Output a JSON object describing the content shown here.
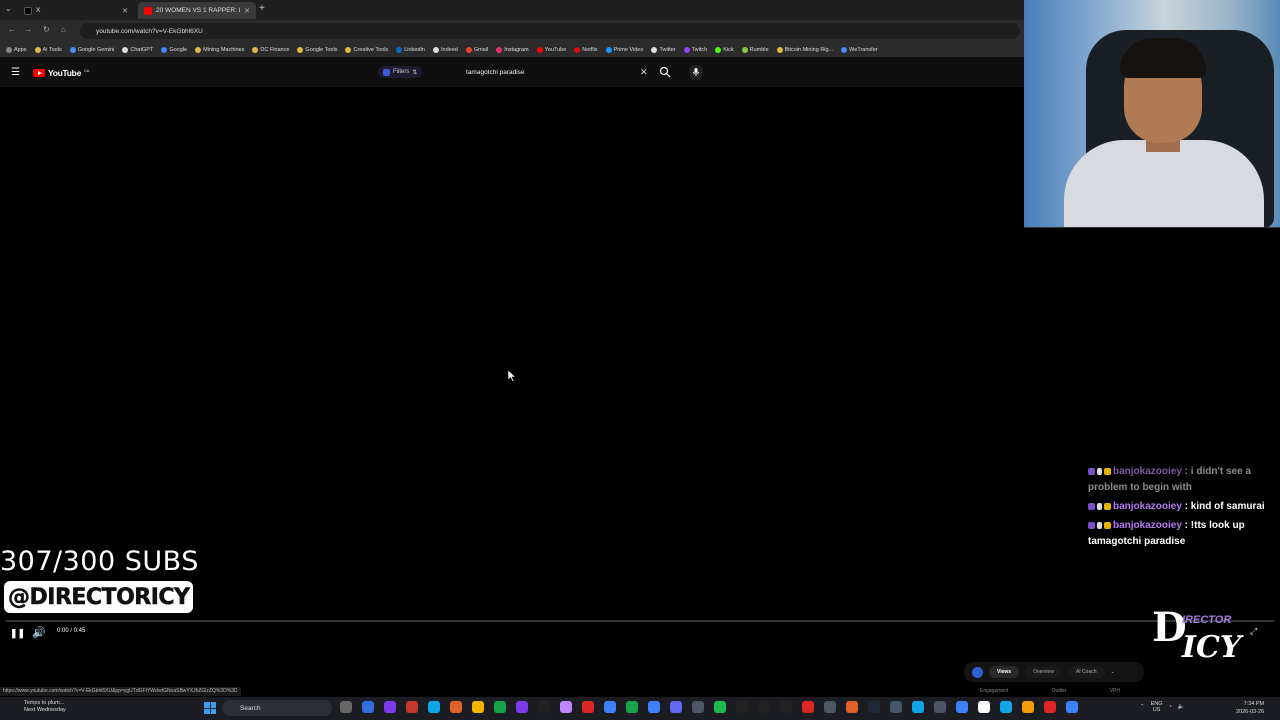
{
  "browser": {
    "tabs": [
      {
        "label": "X",
        "favicon_color": "#000000"
      },
      {
        "label": "20 WOMEN VS 1 RAPPER: I",
        "favicon_color": "#ff0000"
      }
    ],
    "url": "youtube.com/watch?v=V-EkGbhl6XU",
    "bookmarks": [
      {
        "label": "Apps",
        "color": "#888888"
      },
      {
        "label": "Ai Tools",
        "color": "#e0b84a"
      },
      {
        "label": "Google Gemini",
        "color": "#4a8ef0"
      },
      {
        "label": "ChatGPT",
        "color": "#dddddd"
      },
      {
        "label": "Google",
        "color": "#4285f4"
      },
      {
        "label": "Mining Machines",
        "color": "#e0b84a"
      },
      {
        "label": "DC Finance",
        "color": "#e0b84a"
      },
      {
        "label": "Google Tools",
        "color": "#e0b84a"
      },
      {
        "label": "Creative Tools",
        "color": "#e0b84a"
      },
      {
        "label": "LinkedIn",
        "color": "#0a66c2"
      },
      {
        "label": "Indeed",
        "color": "#dddddd"
      },
      {
        "label": "Gmail",
        "color": "#ea4335"
      },
      {
        "label": "Instagram",
        "color": "#e1306c"
      },
      {
        "label": "YouTube",
        "color": "#ff0000"
      },
      {
        "label": "Netflix",
        "color": "#e50914"
      },
      {
        "label": "Prime Video",
        "color": "#1a98ff"
      },
      {
        "label": "Twitter",
        "color": "#dddddd"
      },
      {
        "label": "Twitch",
        "color": "#9146ff"
      },
      {
        "label": "Kick",
        "color": "#53fc18"
      },
      {
        "label": "Rumble",
        "color": "#85c742"
      },
      {
        "label": "Bitcoin Mining Rig...",
        "color": "#e0b84a"
      },
      {
        "label": "WeTransfer",
        "color": "#4a8ef0"
      }
    ],
    "status_url": "https://www.youtube.com/watch?v=V-EkGbhl6XU&pp=ygUTdGFtYWdvdGNoaSBwYXJhZGlzZQ%3D%3D"
  },
  "youtube": {
    "logo_text": "YouTube",
    "country": "CA",
    "filters_label": "Filters",
    "search_value": "tamagotchi paradise",
    "player": {
      "time": "0:00 / 0:45",
      "progress": 0
    }
  },
  "overlay": {
    "subs_count": "307/300 SUBS",
    "handle": "@DIRECTORICY",
    "logo_irector": "IRECTOR",
    "logo_d": "D",
    "logo_icy": "ICY"
  },
  "chat": [
    {
      "user": "banjokazooiey",
      "text": "i didn't see a problem to begin with"
    },
    {
      "user": "banjokazooiey",
      "text": "kind of samurai"
    },
    {
      "user": "banjokazooiey",
      "text": "!tts look up tamagotchi paradise"
    }
  ],
  "extension": {
    "tabs": [
      "Views",
      "Overview",
      "AI Coach"
    ],
    "labels": [
      "Engagement",
      "Outlier",
      "VPH"
    ]
  },
  "taskbar": {
    "weather_title": "Temps to plum...",
    "weather_sub": "Next Wednesday",
    "search_placeholder": "Search",
    "lang": "ENG",
    "region": "US",
    "time": "7:34 PM",
    "date": "2026-03-26",
    "app_colors": [
      "#666666",
      "#2f6fe0",
      "#7c3aed",
      "#c0392b",
      "#0ea5e9",
      "#e0612a",
      "#f5b400",
      "#16a34a",
      "#7c3aed",
      "#222222",
      "#c084fc",
      "#dc2626",
      "#3b82f6",
      "#16a34a",
      "#3b82f6",
      "#6366f1",
      "#4b5563",
      "#1db954",
      "#222222",
      "#222222",
      "#222222",
      "#dc2626",
      "#4b5563",
      "#e0612a",
      "#1f2937",
      "#475569",
      "#0ea5e9",
      "#4b5563",
      "#3b82f6",
      "#ffffff",
      "#0ea5e9",
      "#f59e0b",
      "#dc2626",
      "#3b82f6"
    ]
  }
}
